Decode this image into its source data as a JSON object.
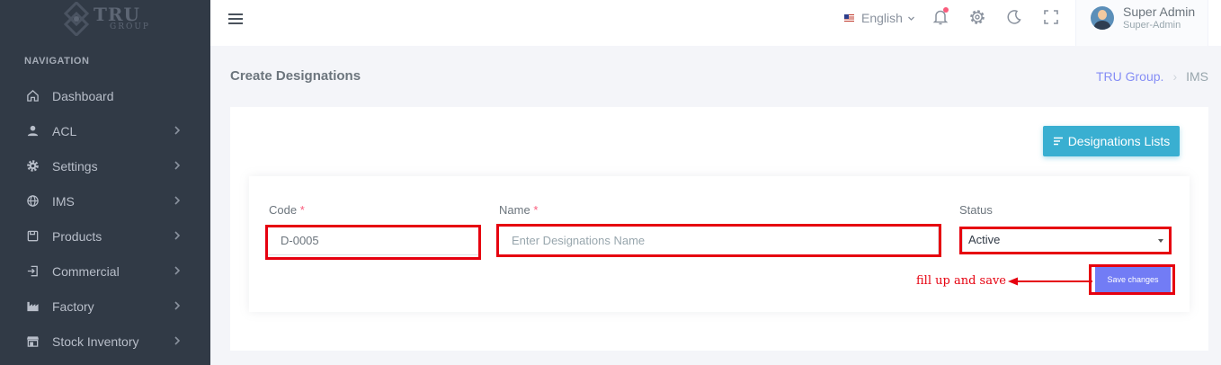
{
  "brand": {
    "name": "TRU",
    "sub": "GROUP"
  },
  "sidebar": {
    "title": "NAVIGATION",
    "items": [
      {
        "label": "Dashboard",
        "icon": "home-icon",
        "has_children": false
      },
      {
        "label": "ACL",
        "icon": "user-icon",
        "has_children": true
      },
      {
        "label": "Settings",
        "icon": "gear-icon",
        "has_children": true
      },
      {
        "label": "IMS",
        "icon": "globe-icon",
        "has_children": true
      },
      {
        "label": "Products",
        "icon": "save-icon",
        "has_children": true
      },
      {
        "label": "Commercial",
        "icon": "login-icon",
        "has_children": true
      },
      {
        "label": "Factory",
        "icon": "factory-icon",
        "has_children": true
      },
      {
        "label": "Stock Inventory",
        "icon": "store-icon",
        "has_children": true
      }
    ]
  },
  "topbar": {
    "language": "English",
    "user": {
      "name": "Super Admin",
      "role": "Super-Admin"
    }
  },
  "page": {
    "title": "Create Designations",
    "breadcrumb": {
      "parent": "TRU Group.",
      "current": "IMS"
    }
  },
  "form": {
    "list_button": "Designations Lists",
    "code": {
      "label": "Code",
      "required_mark": "*",
      "value": "D-0005"
    },
    "name": {
      "label": "Name",
      "required_mark": "*",
      "value": "",
      "placeholder": "Enter Designations Name"
    },
    "status": {
      "label": "Status",
      "value": "Active"
    },
    "save_label": "Save changes"
  },
  "annotation": {
    "text": "fill up and save",
    "color": "#e6000f"
  },
  "colors": {
    "sidebar": "#313a46",
    "primary": "#727cf5",
    "info": "#39afd1",
    "highlight": "#e6000f"
  }
}
